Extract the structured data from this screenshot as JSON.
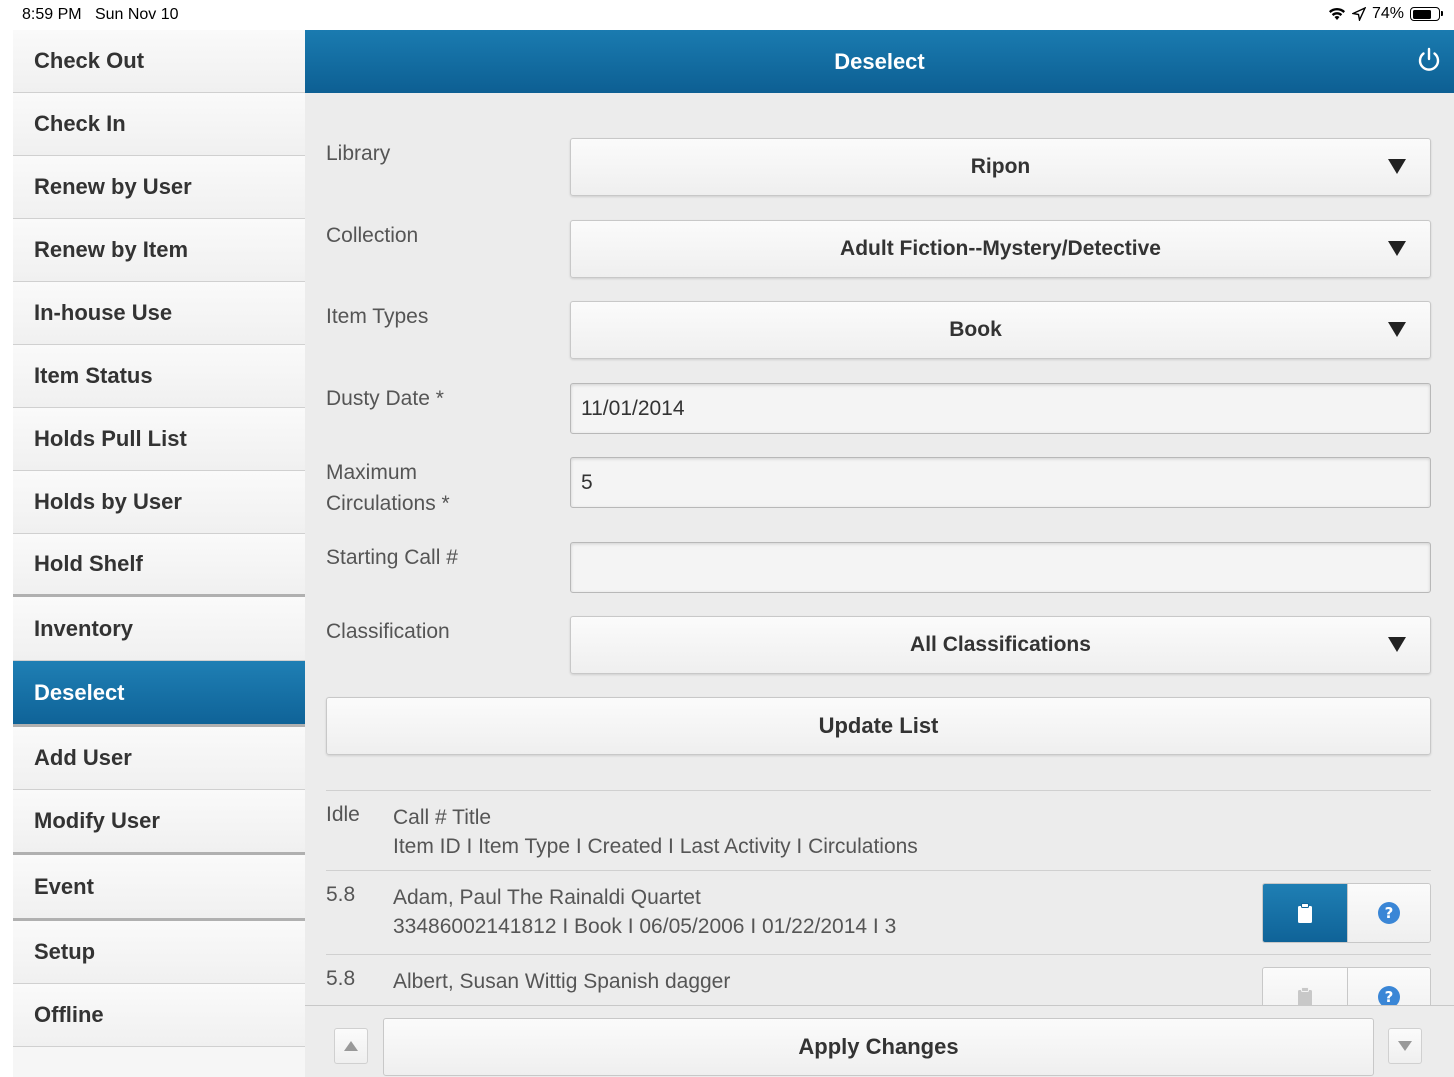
{
  "status_bar": {
    "time": "8:59 PM",
    "date": "Sun Nov 10",
    "battery": "74%"
  },
  "sidebar": {
    "items": [
      {
        "label": "Check Out"
      },
      {
        "label": "Check In"
      },
      {
        "label": "Renew by User"
      },
      {
        "label": "Renew by Item"
      },
      {
        "label": "In-house Use"
      },
      {
        "label": "Item Status"
      },
      {
        "label": "Holds Pull List"
      },
      {
        "label": "Holds by User"
      },
      {
        "label": "Hold Shelf"
      },
      {
        "label": "Inventory"
      },
      {
        "label": "Deselect"
      },
      {
        "label": "Add User"
      },
      {
        "label": "Modify User"
      },
      {
        "label": "Event"
      },
      {
        "label": "Setup"
      },
      {
        "label": "Offline"
      }
    ],
    "active": "Deselect"
  },
  "header": {
    "title": "Deselect"
  },
  "form": {
    "library_label": "Library",
    "library_value": "Ripon",
    "collection_label": "Collection",
    "collection_value": "Adult Fiction--Mystery/Detective",
    "item_types_label": "Item Types",
    "item_types_value": "Book",
    "dusty_date_label": "Dusty Date *",
    "dusty_date_value": "11/01/2014",
    "max_circ_label_1": "Maximum",
    "max_circ_label_2": "Circulations *",
    "max_circ_value": "5",
    "starting_call_label": "Starting Call #",
    "starting_call_value": "",
    "classification_label": "Classification",
    "classification_value": "All Classifications",
    "update_button": "Update List"
  },
  "list": {
    "header_idle": "Idle",
    "header_line1": "Call # Title",
    "header_line2": "Item ID I Item Type I Created I Last Activity I Circulations",
    "rows": [
      {
        "idle": "5.8",
        "line1": "Adam, Paul The Rainaldi Quartet",
        "line2": "33486002141812 I Book I 06/05/2006 I 01/22/2014 I 3",
        "selected": true
      },
      {
        "idle": "5.8",
        "line1": "Albert, Susan Wittig Spanish dagger",
        "line2": "",
        "selected": false
      }
    ]
  },
  "footer": {
    "apply_button": "Apply Changes"
  },
  "colors": {
    "accent": "#1a7bb0",
    "help_blue": "#3a86d6"
  }
}
